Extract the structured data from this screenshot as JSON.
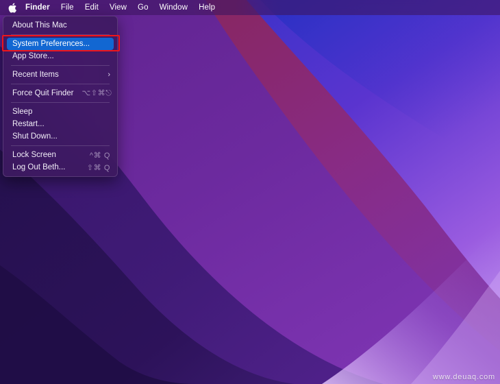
{
  "menubar": {
    "apple_icon": "apple-logo-icon",
    "items": [
      {
        "label": "Finder",
        "bold": true
      },
      {
        "label": "File",
        "bold": false
      },
      {
        "label": "Edit",
        "bold": false
      },
      {
        "label": "View",
        "bold": false
      },
      {
        "label": "Go",
        "bold": false
      },
      {
        "label": "Window",
        "bold": false
      },
      {
        "label": "Help",
        "bold": false
      }
    ]
  },
  "apple_menu": {
    "rows": [
      {
        "label": "About This Mac",
        "accel": "",
        "submenu": false,
        "selected": false
      },
      {
        "label": "System Preferences...",
        "accel": "",
        "submenu": false,
        "selected": true
      },
      {
        "label": "App Store...",
        "accel": "",
        "submenu": false,
        "selected": false
      },
      {
        "label": "Recent Items",
        "accel": "",
        "submenu": true,
        "selected": false
      },
      {
        "label": "Force Quit Finder",
        "accel": "⌥⇧⌘⎋",
        "submenu": false,
        "selected": false
      },
      {
        "label": "Sleep",
        "accel": "",
        "submenu": false,
        "selected": false
      },
      {
        "label": "Restart...",
        "accel": "",
        "submenu": false,
        "selected": false
      },
      {
        "label": "Shut Down...",
        "accel": "",
        "submenu": false,
        "selected": false
      },
      {
        "label": "Lock Screen",
        "accel": "^⌘ Q",
        "submenu": false,
        "selected": false
      },
      {
        "label": "Log Out Beth...",
        "accel": "⇧⌘ Q",
        "submenu": false,
        "selected": false
      }
    ],
    "chevron_glyph": "›",
    "highlight_color": "#1267d2"
  },
  "annotation": {
    "target_label": "System Preferences...",
    "box_color": "#f0151a"
  },
  "watermark": {
    "text": "www.deuaq.com"
  },
  "wallpaper": {
    "name": "macos-monterey-purple-waves",
    "colors": {
      "deep_blue": "#2b2fbe",
      "blue": "#3d3ad6",
      "violet": "#7b3fd1",
      "magenta": "#8a2a86",
      "crimson": "#8e2350",
      "dark_purple": "#2e1259",
      "light_lilac": "#b487e8"
    }
  }
}
